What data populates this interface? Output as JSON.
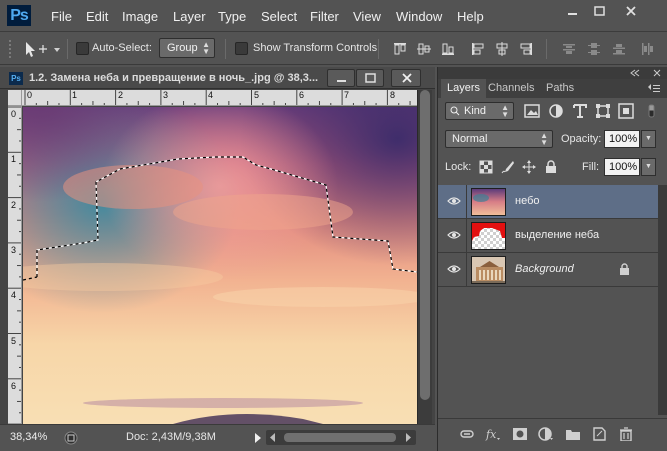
{
  "app": {
    "logo": "Ps",
    "menu": [
      "File",
      "Edit",
      "Image",
      "Layer",
      "Type",
      "Select",
      "Filter",
      "View",
      "Window",
      "Help"
    ],
    "window_controls": [
      "minimize-icon",
      "restore-icon",
      "close-icon"
    ]
  },
  "options": {
    "auto_select_label": "Auto-Select:",
    "auto_select_checked": false,
    "group_value": "Group",
    "show_transform_label": "Show Transform Controls",
    "show_transform_checked": false
  },
  "document": {
    "icon": "Ps",
    "title": "1.2. Замена неба и превращение в ночь_.jpg @ 38,3...",
    "ruler_top": [
      "0",
      "1",
      "2",
      "3",
      "4",
      "5",
      "6",
      "7",
      "8"
    ],
    "ruler_left": [
      "0",
      "1",
      "2",
      "3",
      "4",
      "5",
      "6"
    ],
    "zoom": "38,34%",
    "doc_size": "Doc: 2,43M/9,38M"
  },
  "layers_panel": {
    "tabs": [
      "Layers",
      "Channels",
      "Paths"
    ],
    "active_tab": "Layers",
    "filter_kind": "Kind",
    "blend_mode": "Normal",
    "opacity_label": "Opacity:",
    "opacity": "100%",
    "lock_label": "Lock:",
    "fill_label": "Fill:",
    "fill": "100%",
    "layers": [
      {
        "name": "небо",
        "visible": true,
        "selected": true,
        "thumb": "sky",
        "locked": false,
        "italic": false
      },
      {
        "name": "выделение неба",
        "visible": true,
        "selected": false,
        "thumb": "mask",
        "locked": false,
        "italic": false
      },
      {
        "name": "Background",
        "visible": true,
        "selected": false,
        "thumb": "building",
        "locked": true,
        "italic": true
      }
    ]
  },
  "colors": {
    "ui_bg": "#535353",
    "selection": "#5e6e87",
    "ps_blue": "#4fa9f0"
  }
}
